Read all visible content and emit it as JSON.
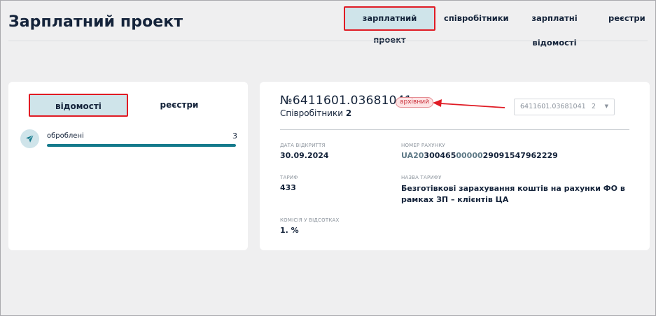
{
  "header": {
    "title": "Зарплатний проект",
    "tabs": [
      {
        "label": "зарплатний проект",
        "active": true
      },
      {
        "label": "співробітники",
        "active": false
      },
      {
        "label": "зарплатні відомості",
        "active": false
      },
      {
        "label": "реєстри",
        "active": false
      }
    ]
  },
  "left_panel": {
    "tabs": [
      {
        "label": "відомості",
        "active": true
      },
      {
        "label": "реєстри",
        "active": false
      }
    ],
    "items": [
      {
        "icon": "send-icon",
        "label": "оброблені",
        "count": "3",
        "progress": 1.0
      }
    ]
  },
  "project": {
    "number": "№6411601.03681041",
    "status_badge": "архівний",
    "employees_label": "Співробітники",
    "employees_count": "2",
    "select": {
      "value": "6411601.03681041",
      "count": "2"
    },
    "fields": {
      "open_date": {
        "label": "Дата відкриття",
        "value": "30.09.2024"
      },
      "account": {
        "label": "Номер рахунку",
        "parts": [
          "UA20",
          "300465",
          "00000",
          "29091547962229"
        ]
      },
      "tariff": {
        "label": "Тариф",
        "value": "433"
      },
      "tariff_name": {
        "label": "Назва тарифу",
        "value": "Безготівкові зарахування коштів на рахунки ФО в рамках ЗП – клієнтів ЦА"
      },
      "commission": {
        "label": "Комісія у відсотках",
        "value": "1. %"
      }
    }
  },
  "colors": {
    "accent": "#157a8c",
    "active_tab_bg": "#cfe4ea",
    "highlight_border": "#e01b24",
    "badge_text": "#c9303a",
    "badge_bg": "#fde3e4",
    "page_bg": "#efeff0",
    "text": "#14233a"
  }
}
